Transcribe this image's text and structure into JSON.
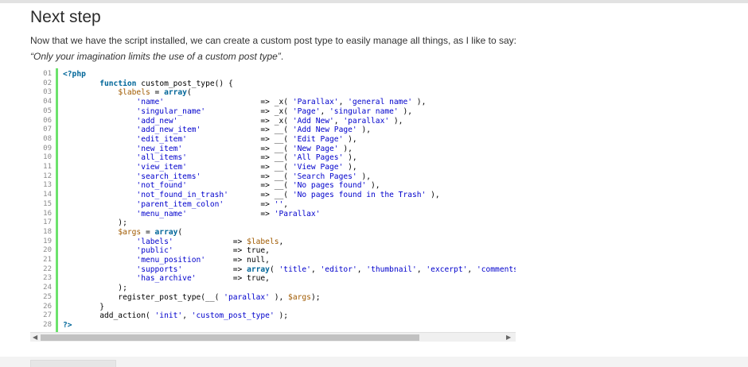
{
  "section": {
    "heading": "Next step",
    "intro_plain": "Now that we have the script installed, we can create a custom post type to easily manage all things, as I like to say: ",
    "intro_quote": "“Only your imagination limits the use of a custom post type”",
    "intro_end": "."
  },
  "code": {
    "line_numbers": [
      "01",
      "02",
      "03",
      "04",
      "05",
      "06",
      "07",
      "08",
      "09",
      "10",
      "11",
      "12",
      "13",
      "14",
      "15",
      "16",
      "17",
      "18",
      "19",
      "20",
      "21",
      "22",
      "23",
      "24",
      "25",
      "26",
      "27",
      "28"
    ],
    "lines": [
      [
        {
          "t": "<?php",
          "c": "kw"
        }
      ],
      [
        {
          "t": "        "
        },
        {
          "t": "function",
          "c": "kw"
        },
        {
          "t": " custom_post_type() {"
        }
      ],
      [
        {
          "t": "            "
        },
        {
          "t": "$labels",
          "c": "var"
        },
        {
          "t": " = "
        },
        {
          "t": "array",
          "c": "kw"
        },
        {
          "t": "("
        }
      ],
      [
        {
          "t": "                "
        },
        {
          "t": "'name'",
          "c": "str"
        },
        {
          "t": "                     => _x( "
        },
        {
          "t": "'Parallax'",
          "c": "str"
        },
        {
          "t": ", "
        },
        {
          "t": "'general name'",
          "c": "str"
        },
        {
          "t": " ),"
        }
      ],
      [
        {
          "t": "                "
        },
        {
          "t": "'singular_name'",
          "c": "str"
        },
        {
          "t": "            => _x( "
        },
        {
          "t": "'Page'",
          "c": "str"
        },
        {
          "t": ", "
        },
        {
          "t": "'singular name'",
          "c": "str"
        },
        {
          "t": " ),"
        }
      ],
      [
        {
          "t": "                "
        },
        {
          "t": "'add_new'",
          "c": "str"
        },
        {
          "t": "                  => _x( "
        },
        {
          "t": "'Add New'",
          "c": "str"
        },
        {
          "t": ", "
        },
        {
          "t": "'parallax'",
          "c": "str"
        },
        {
          "t": " ),"
        }
      ],
      [
        {
          "t": "                "
        },
        {
          "t": "'add_new_item'",
          "c": "str"
        },
        {
          "t": "             => __( "
        },
        {
          "t": "'Add New Page'",
          "c": "str"
        },
        {
          "t": " ),"
        }
      ],
      [
        {
          "t": "                "
        },
        {
          "t": "'edit_item'",
          "c": "str"
        },
        {
          "t": "                => __( "
        },
        {
          "t": "'Edit Page'",
          "c": "str"
        },
        {
          "t": " ),"
        }
      ],
      [
        {
          "t": "                "
        },
        {
          "t": "'new_item'",
          "c": "str"
        },
        {
          "t": "                 => __( "
        },
        {
          "t": "'New Page'",
          "c": "str"
        },
        {
          "t": " ),"
        }
      ],
      [
        {
          "t": "                "
        },
        {
          "t": "'all_items'",
          "c": "str"
        },
        {
          "t": "                => __( "
        },
        {
          "t": "'All Pages'",
          "c": "str"
        },
        {
          "t": " ),"
        }
      ],
      [
        {
          "t": "                "
        },
        {
          "t": "'view_item'",
          "c": "str"
        },
        {
          "t": "                => __( "
        },
        {
          "t": "'View Page'",
          "c": "str"
        },
        {
          "t": " ),"
        }
      ],
      [
        {
          "t": "                "
        },
        {
          "t": "'search_items'",
          "c": "str"
        },
        {
          "t": "             => __( "
        },
        {
          "t": "'Search Pages'",
          "c": "str"
        },
        {
          "t": " ),"
        }
      ],
      [
        {
          "t": "                "
        },
        {
          "t": "'not_found'",
          "c": "str"
        },
        {
          "t": "                => __( "
        },
        {
          "t": "'No pages found'",
          "c": "str"
        },
        {
          "t": " ),"
        }
      ],
      [
        {
          "t": "                "
        },
        {
          "t": "'not_found_in_trash'",
          "c": "str"
        },
        {
          "t": "       => __( "
        },
        {
          "t": "'No pages found in the Trash'",
          "c": "str"
        },
        {
          "t": " ),"
        }
      ],
      [
        {
          "t": "                "
        },
        {
          "t": "'parent_item_colon'",
          "c": "str"
        },
        {
          "t": "        => "
        },
        {
          "t": "''",
          "c": "str"
        },
        {
          "t": ","
        }
      ],
      [
        {
          "t": "                "
        },
        {
          "t": "'menu_name'",
          "c": "str"
        },
        {
          "t": "                => "
        },
        {
          "t": "'Parallax'",
          "c": "str"
        }
      ],
      [
        {
          "t": "            );"
        }
      ],
      [
        {
          "t": "            "
        },
        {
          "t": "$args",
          "c": "var"
        },
        {
          "t": " = "
        },
        {
          "t": "array",
          "c": "kw"
        },
        {
          "t": "("
        }
      ],
      [
        {
          "t": "                "
        },
        {
          "t": "'labels'",
          "c": "str"
        },
        {
          "t": "             => "
        },
        {
          "t": "$labels",
          "c": "var"
        },
        {
          "t": ","
        }
      ],
      [
        {
          "t": "                "
        },
        {
          "t": "'public'",
          "c": "str"
        },
        {
          "t": "             => true,"
        }
      ],
      [
        {
          "t": "                "
        },
        {
          "t": "'menu_position'",
          "c": "str"
        },
        {
          "t": "      => null,"
        }
      ],
      [
        {
          "t": "                "
        },
        {
          "t": "'supports'",
          "c": "str"
        },
        {
          "t": "           => "
        },
        {
          "t": "array",
          "c": "kw"
        },
        {
          "t": "( "
        },
        {
          "t": "'title'",
          "c": "str"
        },
        {
          "t": ", "
        },
        {
          "t": "'editor'",
          "c": "str"
        },
        {
          "t": ", "
        },
        {
          "t": "'thumbnail'",
          "c": "str"
        },
        {
          "t": ", "
        },
        {
          "t": "'excerpt'",
          "c": "str"
        },
        {
          "t": ", "
        },
        {
          "t": "'comments'",
          "c": "str"
        },
        {
          "t": ","
        }
      ],
      [
        {
          "t": "                "
        },
        {
          "t": "'has_archive'",
          "c": "str"
        },
        {
          "t": "        => true,"
        }
      ],
      [
        {
          "t": "            );"
        }
      ],
      [
        {
          "t": "            register_post_type(__( "
        },
        {
          "t": "'parallax'",
          "c": "str"
        },
        {
          "t": " ), "
        },
        {
          "t": "$args",
          "c": "var"
        },
        {
          "t": ");"
        }
      ],
      [
        {
          "t": "        }"
        }
      ],
      [
        {
          "t": "        add_action( "
        },
        {
          "t": "'init'",
          "c": "str"
        },
        {
          "t": ", "
        },
        {
          "t": "'custom_post_type'",
          "c": "str"
        },
        {
          "t": " );"
        }
      ],
      [
        {
          "t": "?>",
          "c": "kw"
        }
      ]
    ]
  },
  "scrollbar": {
    "left_icon": "left-arrow-icon",
    "right_icon": "right-arrow-icon",
    "left_glyph": "◀",
    "right_glyph": "▶"
  },
  "colors": {
    "gutter_accent": "#6ce26c",
    "keyword": "#006699",
    "string": "#0000cc",
    "variable": "#a05a00"
  }
}
